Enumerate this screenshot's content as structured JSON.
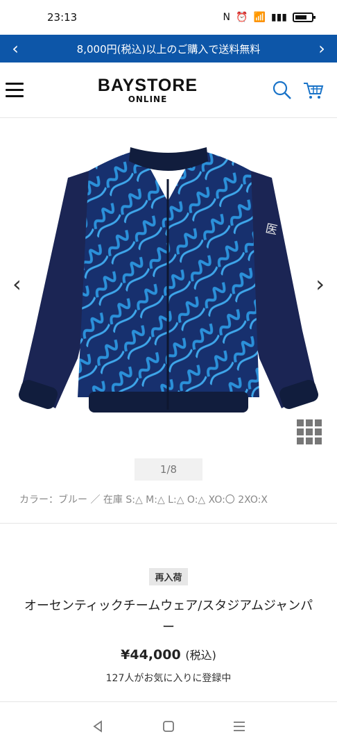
{
  "status": {
    "time": "23:13"
  },
  "promo": {
    "text": "8,000円(税込)以上のご購入で送料無料"
  },
  "header": {
    "logo_main": "BAYSTORE",
    "logo_sub": "ONLINE"
  },
  "gallery": {
    "pager": "1/8"
  },
  "product": {
    "stock_text": "カラー：ブルー ／ 在庫 S:△ M:△ L:△ O:△ XO:〇 2XO:X",
    "badge": "再入荷",
    "title": "オーセンティックチームウェア/スタジアムジャンパー",
    "price": "¥44,000",
    "tax_label": "(税込)",
    "favorites": "127人がお気に入りに登録中"
  },
  "colors": {
    "promo_bg": "#0d56a8",
    "jacket_navy": "#1b2554",
    "jacket_print": "#2b90d9"
  },
  "icons": {
    "menu": "hamburger-menu-icon",
    "search": "search-icon",
    "cart": "cart-icon",
    "grid": "grid-view-icon"
  }
}
